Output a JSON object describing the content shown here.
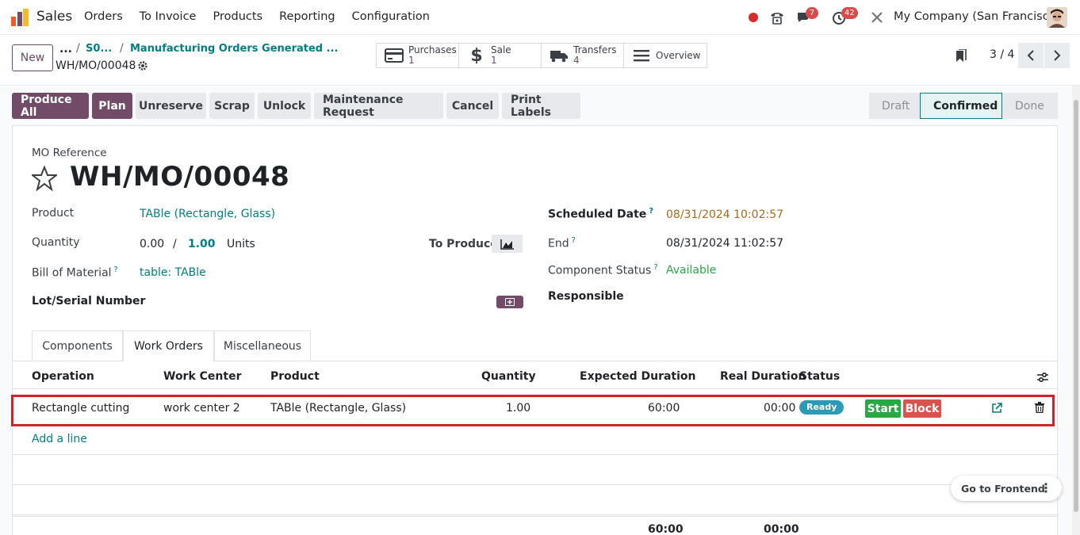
{
  "navbar": {
    "app_name": "Sales",
    "menu": [
      "Orders",
      "To Invoice",
      "Products",
      "Reporting",
      "Configuration"
    ],
    "chat_count": "7",
    "activity_count": "42",
    "company": "My Company (San Francisco)"
  },
  "control_panel": {
    "new_label": "New",
    "breadcrumb": {
      "ellipsis": "...",
      "so": "S0...",
      "mo_list": "Manufacturing Orders Generated ...",
      "current": "WH/MO/00048"
    },
    "smart_buttons": [
      {
        "label": "Purchases",
        "value": "1",
        "icon": "credit-card-icon"
      },
      {
        "label": "Sale",
        "value": "1",
        "icon": "dollar-icon"
      },
      {
        "label": "Transfers",
        "value": "4",
        "icon": "truck-icon"
      },
      {
        "label": "Overview",
        "value": "",
        "icon": "bars-icon"
      }
    ],
    "pager": "3 / 4"
  },
  "actions": {
    "produce_all": "Produce All",
    "plan": "Plan",
    "unreserve": "Unreserve",
    "scrap": "Scrap",
    "unlock": "Unlock",
    "maintenance": "Maintenance Request",
    "cancel": "Cancel",
    "print_labels": "Print Labels"
  },
  "status": {
    "stages": [
      "Draft",
      "Confirmed",
      "Done"
    ],
    "current": "Confirmed"
  },
  "form": {
    "ref_label": "MO Reference",
    "title": "WH/MO/00048",
    "product_label": "Product",
    "product_value": "TABle (Rectangle, Glass)",
    "quantity_label": "Quantity",
    "quantity_produced": "0.00",
    "quantity_sep": "/",
    "quantity_total": "1.00",
    "quantity_uom": "Units",
    "to_produce_label": "To Produce",
    "bom_label": "Bill of Material",
    "bom_value": "table: TABle",
    "lot_label": "Lot/Serial Number",
    "scheduled_label": "Scheduled Date",
    "scheduled_value": "08/31/2024 10:02:57",
    "end_label": "End",
    "end_value": "08/31/2024 11:02:57",
    "component_status_label": "Component Status",
    "component_status_value": "Available",
    "responsible_label": "Responsible",
    "help_mark": "?"
  },
  "tabs": [
    "Components",
    "Work Orders",
    "Miscellaneous"
  ],
  "work_orders": {
    "columns": [
      "Operation",
      "Work Center",
      "Product",
      "Quantity",
      "Expected Duration",
      "Real Duration",
      "Status"
    ],
    "rows": [
      {
        "operation": "Rectangle cutting",
        "work_center": "work center 2",
        "product": "TABle (Rectangle, Glass)",
        "quantity": "1.00",
        "expected": "60:00",
        "real": "00:00",
        "status": "Ready",
        "start": "Start",
        "block": "Block"
      }
    ],
    "add_line": "Add a line",
    "total_expected": "60:00",
    "total_real": "00:00"
  },
  "floating": {
    "go_frontend": "Go to Frontend"
  },
  "colors": {
    "primary": "#714b67",
    "link": "#017e84",
    "ready": "#2b9bb5",
    "start": "#28a745",
    "block": "#d9534f",
    "highlight": "#c9262a"
  }
}
